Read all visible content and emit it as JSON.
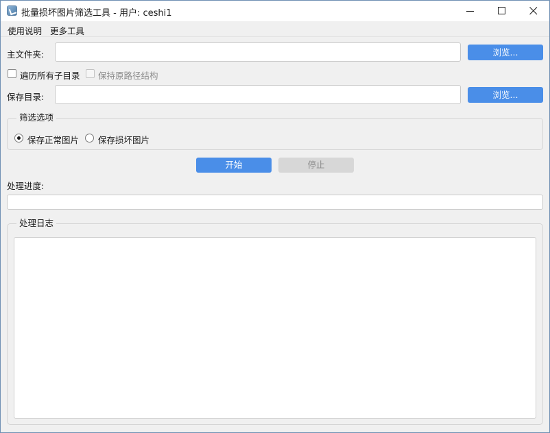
{
  "window": {
    "title": "批量损坏图片筛选工具 - 用户: ceshi1"
  },
  "menu": {
    "items": [
      {
        "label": "使用说明"
      },
      {
        "label": "更多工具"
      }
    ]
  },
  "source": {
    "label": "主文件夹:",
    "value": "",
    "browse_label": "浏览..."
  },
  "options": {
    "traverse_label": "遍历所有子目录",
    "traverse_checked": false,
    "keep_structure_label": "保持原路径结构",
    "keep_structure_checked": false,
    "keep_structure_enabled": false
  },
  "save": {
    "label": "保存目录:",
    "value": "",
    "browse_label": "浏览..."
  },
  "filter": {
    "group_title": "筛选选项",
    "normal_label": "保存正常图片",
    "damaged_label": "保存损坏图片",
    "selected": "normal"
  },
  "actions": {
    "start_label": "开始",
    "stop_label": "停止"
  },
  "progress": {
    "label": "处理进度:",
    "value": 0
  },
  "log": {
    "group_title": "处理日志",
    "content": ""
  },
  "colors": {
    "accent": "#4a8ee8",
    "disabled_button": "#d7d7d7"
  }
}
